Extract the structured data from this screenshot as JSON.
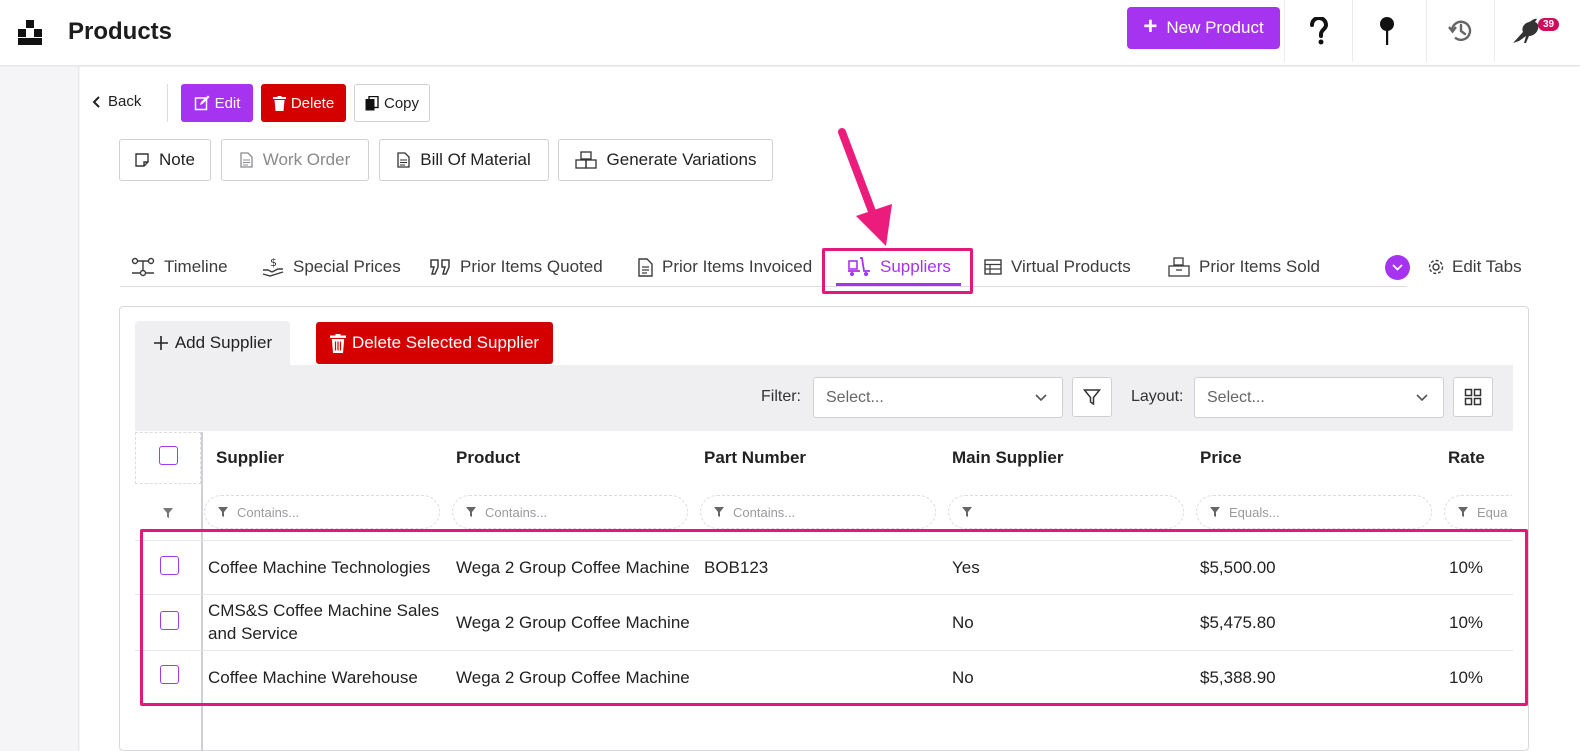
{
  "header": {
    "title": "Products",
    "new_product_label": "New Product",
    "notifications_count": "39"
  },
  "actions": {
    "back_label": "Back",
    "edit_label": "Edit",
    "delete_label": "Delete",
    "copy_label": "Copy"
  },
  "secondary_actions": {
    "note_label": "Note",
    "work_order_label": "Work Order",
    "bom_label": "Bill Of Material",
    "generate_variations_label": "Generate Variations"
  },
  "tabs": [
    {
      "label": "Timeline",
      "icon": "timeline-icon"
    },
    {
      "label": "Special Prices",
      "icon": "hand-dollar-icon"
    },
    {
      "label": "Prior Items Quoted",
      "icon": "quote-icon"
    },
    {
      "label": "Prior Items Invoiced",
      "icon": "invoice-icon"
    },
    {
      "label": "Suppliers",
      "icon": "dolly-icon",
      "active": true
    },
    {
      "label": "Virtual Products",
      "icon": "table-icon"
    },
    {
      "label": "Prior Items Sold",
      "icon": "boxes-icon"
    }
  ],
  "edit_tabs_label": "Edit Tabs",
  "panel": {
    "add_supplier_label": "Add Supplier",
    "delete_selected_label": "Delete Selected Supplier",
    "filter_label": "Filter:",
    "filter_placeholder": "Select...",
    "layout_label": "Layout:",
    "layout_placeholder": "Select..."
  },
  "grid": {
    "columns": [
      "Supplier",
      "Product",
      "Part Number",
      "Main Supplier",
      "Price",
      "Rate"
    ],
    "filters": [
      "Contains...",
      "Contains...",
      "Contains...",
      "",
      "Equals...",
      "Equa"
    ],
    "rows": [
      {
        "supplier": "Coffee Machine Technologies",
        "product": "Wega 2 Group Coffee Machine",
        "part_number": "BOB123",
        "main_supplier": "Yes",
        "price": "$5,500.00",
        "rate": "10%"
      },
      {
        "supplier": "CMS&S Coffee Machine Sales and Service",
        "product": "Wega 2 Group Coffee Machine",
        "part_number": "",
        "main_supplier": "No",
        "price": "$5,475.80",
        "rate": "10%"
      },
      {
        "supplier": "Coffee Machine Warehouse",
        "product": "Wega 2 Group Coffee Machine",
        "part_number": "",
        "main_supplier": "No",
        "price": "$5,388.90",
        "rate": "10%"
      }
    ]
  },
  "colors": {
    "accent": "#a633f0",
    "danger": "#d40000",
    "annotation": "#e6177a"
  }
}
